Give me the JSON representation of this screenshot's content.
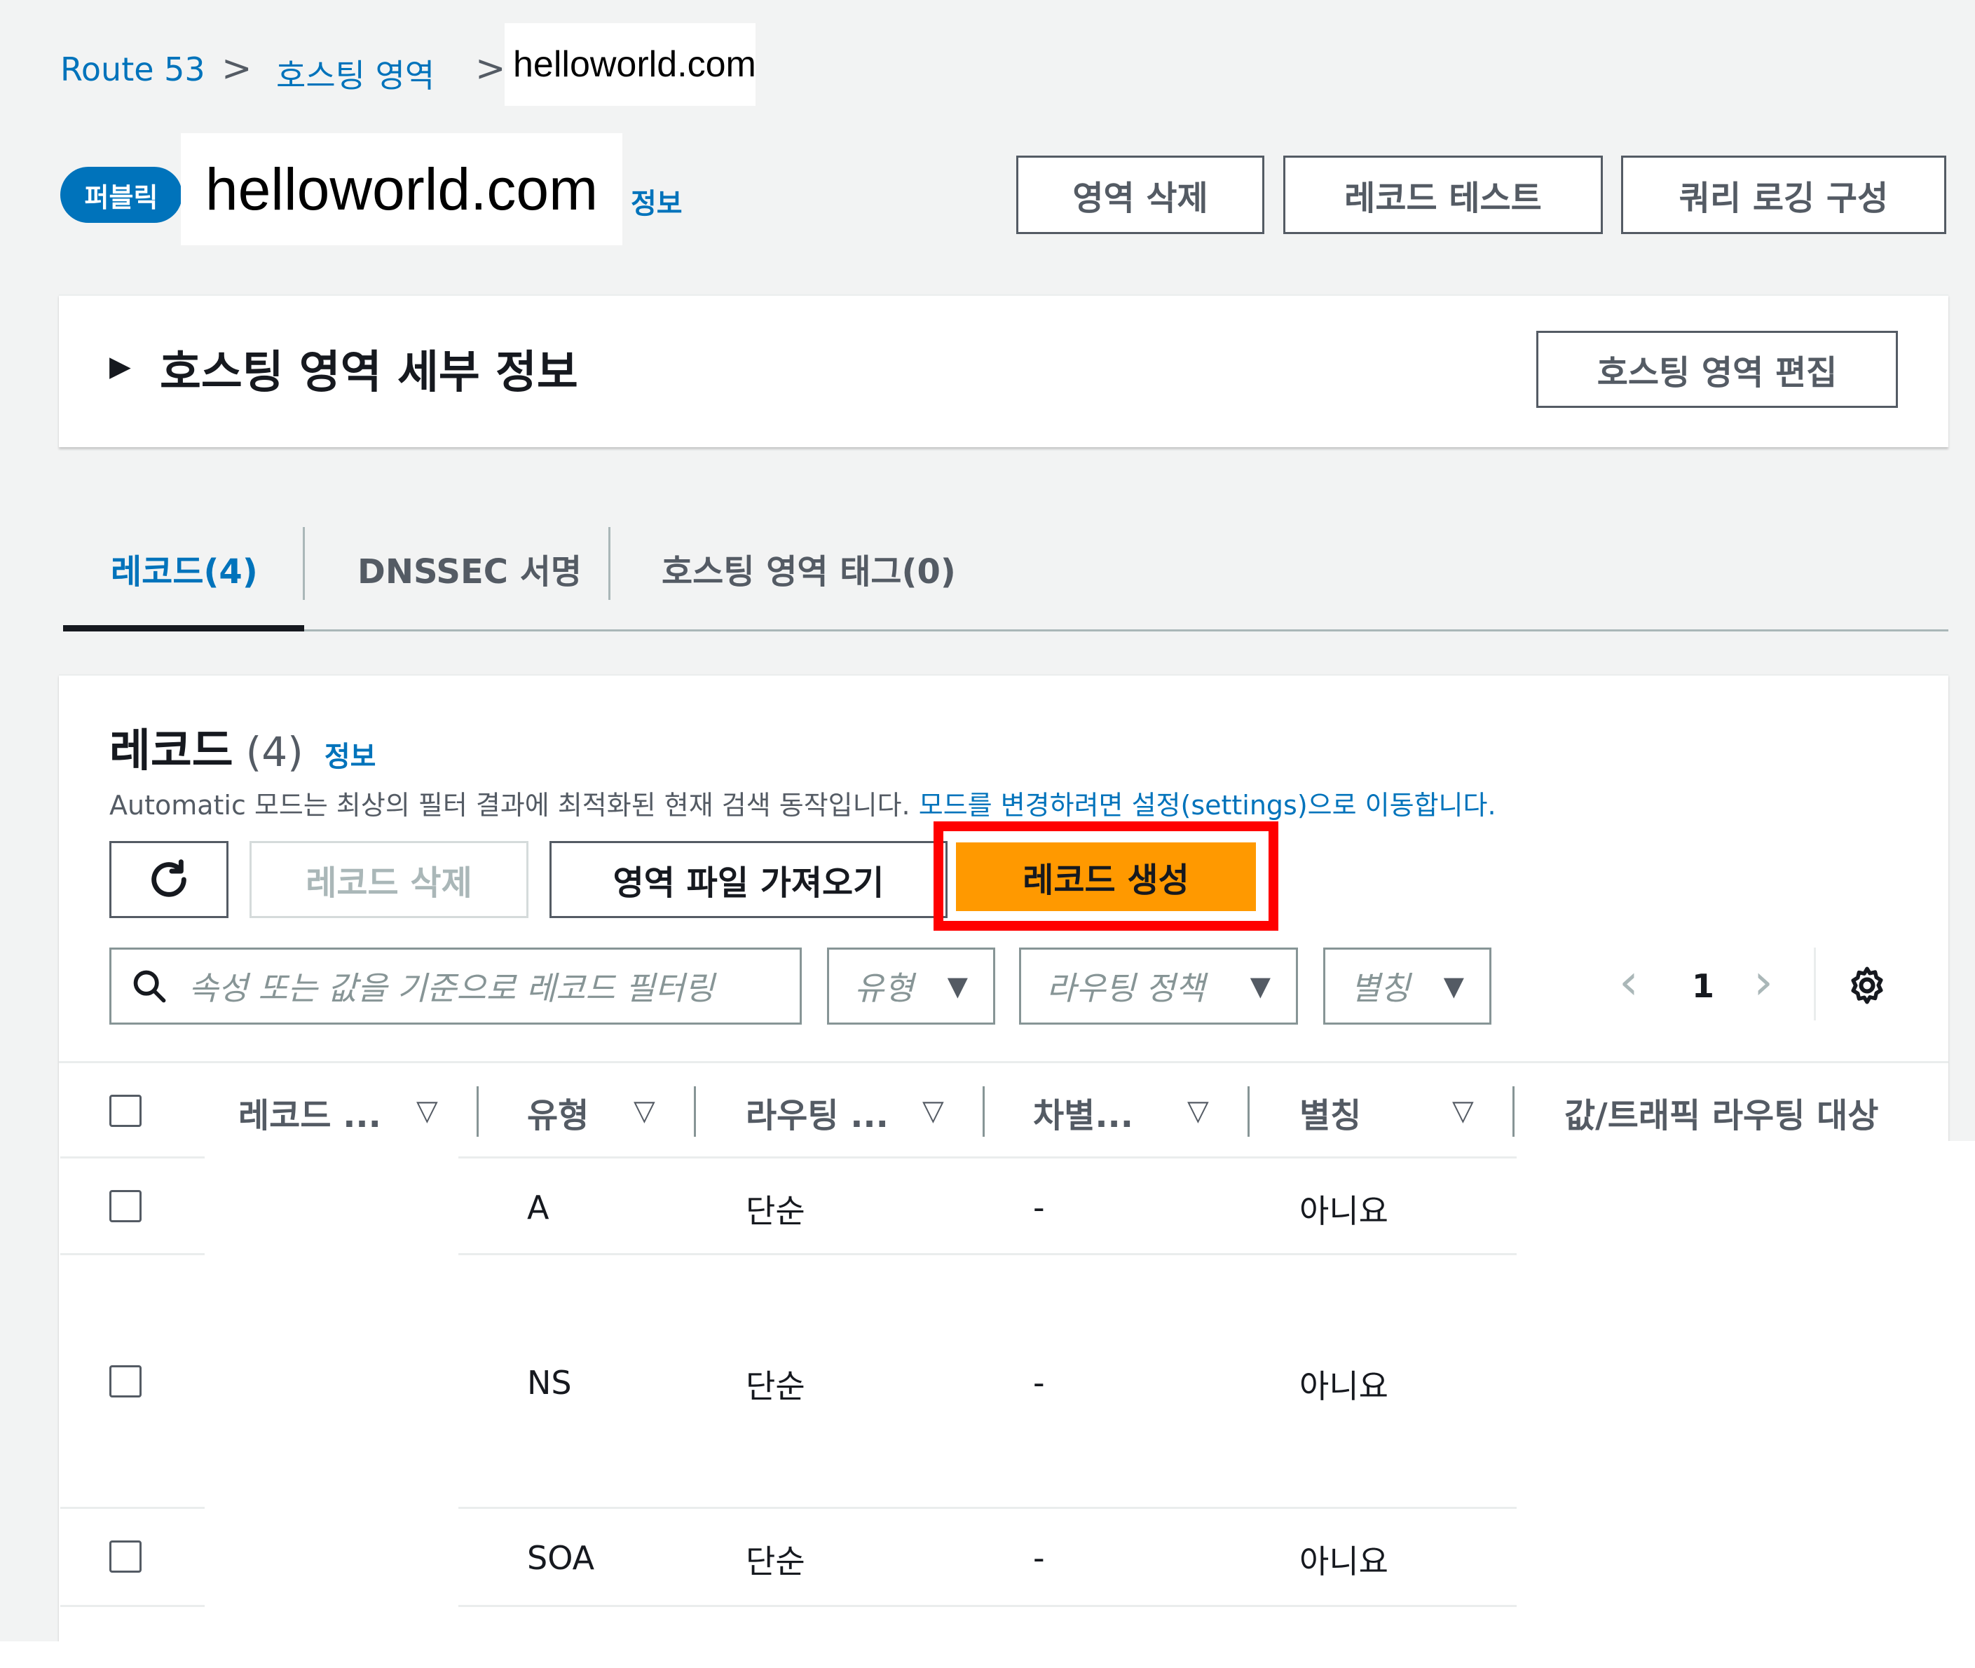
{
  "breadcrumb": {
    "items": [
      "Route 53",
      "호스팅 영역"
    ],
    "separator": ">",
    "current": "helloworld.com"
  },
  "header": {
    "badge": "퍼블릭",
    "title": "helloworld.com",
    "info": "정보",
    "buttons": [
      "영역 삭제",
      "레코드 테스트",
      "쿼리 로깅 구성"
    ]
  },
  "details": {
    "toggle": "▶",
    "title": "호스팅 영역 세부 정보",
    "edit_button": "호스팅 영역 편집"
  },
  "tabs": [
    {
      "label": "레코드(4)",
      "active": true
    },
    {
      "label": "DNSSEC 서명",
      "active": false
    },
    {
      "label": "호스팅 영역 태그(0)",
      "active": false
    }
  ],
  "records": {
    "title": "레코드",
    "count": "(4)",
    "info": "정보",
    "description": "Automatic 모드는 최상의 필터 결과에 최적화된 현재 검색 동작입니다.",
    "description_link": "모드를 변경하려면 설정(settings)으로 이동합니다.",
    "actions": {
      "refresh_icon": "refresh-icon",
      "delete": "레코드 삭제",
      "import": "영역 파일 가져오기",
      "create": "레코드 생성"
    },
    "highlight_color": "#ff0000",
    "search_placeholder": "속성 또는 값을 기준으로 레코드 필터링",
    "filters": [
      "유형",
      "라우팅 정책",
      "별칭"
    ],
    "page": "1",
    "columns": [
      "레코드 ...",
      "유형",
      "라우팅 ...",
      "차별...",
      "별칭",
      "값/트래픽 라우팅 대상"
    ],
    "rows": [
      {
        "type": "A",
        "routing": "단순",
        "diff": "-",
        "alias": "아니요"
      },
      {
        "type": "NS",
        "routing": "단순",
        "diff": "-",
        "alias": "아니요"
      },
      {
        "type": "SOA",
        "routing": "단순",
        "diff": "-",
        "alias": "아니요"
      }
    ]
  },
  "colors": {
    "link": "#0073bb",
    "primary": "#ff9900",
    "highlight": "#ff0000"
  }
}
